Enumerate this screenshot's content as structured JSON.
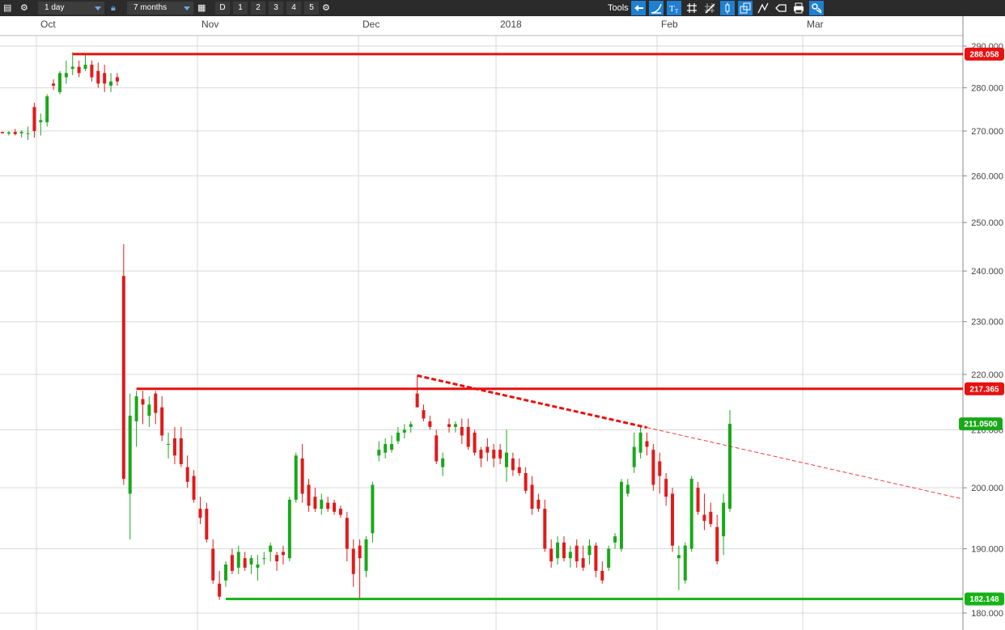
{
  "toolbar": {
    "interval": "1 day",
    "range": "7 months",
    "periods": [
      "D",
      "1",
      "2",
      "3",
      "4",
      "5"
    ],
    "tools_label": "Tools",
    "tool_icons": [
      "back-icon",
      "line-tool-icon",
      "text-tool-icon",
      "grid-icon",
      "draw-tool-icon",
      "candle-icon",
      "compare-icon",
      "indicator-icon",
      "label-icon",
      "print-icon",
      "settings-tool-icon"
    ]
  },
  "colors": {
    "up": "#1aa81a",
    "down": "#e01b1b",
    "resistance": "#e81010",
    "support": "#16b316",
    "grid": "#d9d9d9",
    "axis_text": "#444444"
  },
  "chart_data": {
    "type": "candlestick",
    "x_axis": {
      "labels": [
        "Oct",
        "Nov",
        "Dec",
        "2018",
        "Feb",
        "Mar"
      ]
    },
    "y_axis": {
      "ticks": [
        "290.000",
        "280.000",
        "270.000",
        "260.000",
        "250.000",
        "240.000",
        "230.000",
        "220.000",
        "210.000",
        "200.000",
        "190.000",
        "180.000"
      ],
      "log_scale": true,
      "range": [
        178.5,
        292
      ]
    },
    "grid": true,
    "horizontal_lines": [
      {
        "label": "288.058",
        "value": 288.058,
        "color": "#e81010"
      },
      {
        "label": "217.365",
        "value": 217.365,
        "color": "#e81010"
      },
      {
        "label": "182.148",
        "value": 182.148,
        "color": "#16b316"
      }
    ],
    "current_price": {
      "label": "211.0500",
      "value": 211.05
    },
    "trendline": {
      "from": [
        219.8,
        "early Dec"
      ],
      "to": [
        210.4,
        "late Jan"
      ],
      "style": "dashed-then-thin-extension"
    },
    "candles": [
      [
        269.8,
        269.8,
        269.4,
        269.5
      ],
      [
        269.4,
        270.0,
        269.0,
        269.7
      ],
      [
        269.8,
        270.5,
        269.0,
        269.3
      ],
      [
        269.5,
        270.2,
        268.5,
        269.8
      ],
      [
        269.5,
        271.0,
        268.0,
        269.5
      ],
      [
        275.5,
        276.5,
        268.5,
        270.0
      ],
      [
        272.0,
        274.0,
        269.0,
        272.5
      ],
      [
        272.0,
        278.5,
        271.0,
        278.0
      ],
      [
        281.0,
        282.0,
        279.5,
        280.5
      ],
      [
        279.0,
        284.0,
        278.5,
        283.5
      ],
      [
        282.5,
        286.5,
        281.0,
        283.5
      ],
      [
        284.5,
        288.5,
        283.0,
        285.0
      ],
      [
        285.0,
        286.5,
        282.5,
        283.5
      ],
      [
        284.5,
        288.0,
        284.0,
        285.5
      ],
      [
        285.5,
        286.5,
        281.5,
        282.5
      ],
      [
        284.0,
        286.0,
        280.0,
        281.0
      ],
      [
        283.5,
        285.5,
        279.0,
        281.0
      ],
      [
        280.5,
        283.5,
        279.0,
        281.5
      ],
      [
        282.5,
        283.5,
        280.5,
        281.5
      ],
      [
        239.0,
        245.5,
        200.5,
        201.5
      ],
      [
        199.0,
        216.5,
        191.5,
        212.5
      ],
      [
        211.5,
        217.0,
        207.0,
        216.0
      ],
      [
        215.5,
        217.0,
        211.0,
        214.5
      ],
      [
        212.5,
        216.0,
        210.5,
        214.5
      ],
      [
        216.5,
        217.0,
        211.0,
        213.0
      ],
      [
        214.0,
        216.0,
        208.0,
        209.0
      ],
      [
        207.5,
        209.5,
        205.0,
        207.5
      ],
      [
        208.5,
        210.5,
        204.0,
        205.5
      ],
      [
        208.5,
        210.5,
        203.5,
        204.0
      ],
      [
        203.5,
        205.5,
        200.0,
        201.0
      ],
      [
        202.0,
        203.0,
        197.5,
        198.0
      ],
      [
        196.5,
        198.5,
        194.0,
        195.0
      ],
      [
        196.5,
        197.5,
        191.0,
        191.5
      ],
      [
        190.0,
        191.5,
        184.5,
        185.0
      ],
      [
        184.5,
        186.5,
        182.0,
        182.5
      ],
      [
        185.0,
        188.0,
        184.0,
        187.5
      ],
      [
        189.0,
        190.0,
        186.0,
        186.5
      ],
      [
        187.0,
        190.5,
        186.0,
        189.5
      ],
      [
        188.5,
        189.5,
        186.5,
        187.0
      ],
      [
        187.5,
        189.0,
        186.0,
        188.5
      ],
      [
        187.0,
        189.0,
        185.0,
        187.5
      ],
      [
        188.5,
        189.5,
        187.5,
        188.5
      ],
      [
        189.5,
        191.0,
        188.0,
        190.5
      ],
      [
        189.0,
        189.5,
        186.5,
        188.0
      ],
      [
        189.5,
        190.5,
        187.5,
        189.0
      ],
      [
        188.5,
        198.5,
        188.0,
        198.0
      ],
      [
        198.0,
        206.0,
        197.5,
        205.5
      ],
      [
        205.0,
        207.5,
        197.5,
        199.0
      ],
      [
        200.5,
        201.5,
        196.0,
        197.0
      ],
      [
        198.5,
        200.0,
        196.0,
        196.5
      ],
      [
        196.5,
        199.0,
        195.5,
        198.0
      ],
      [
        197.5,
        198.5,
        196.0,
        196.5
      ],
      [
        197.5,
        198.0,
        195.5,
        196.0
      ],
      [
        196.5,
        197.0,
        195.0,
        195.5
      ],
      [
        195.0,
        196.0,
        188.0,
        190.0
      ],
      [
        190.0,
        191.5,
        184.0,
        186.0
      ],
      [
        190.5,
        191.5,
        182.0,
        188.5
      ],
      [
        186.5,
        192.0,
        185.5,
        191.5
      ],
      [
        192.5,
        201.0,
        191.0,
        200.5
      ],
      [
        205.5,
        208.0,
        204.5,
        206.5
      ],
      [
        206.0,
        208.5,
        205.0,
        207.5
      ],
      [
        206.5,
        209.0,
        206.0,
        207.5
      ],
      [
        208.0,
        210.5,
        207.5,
        209.5
      ],
      [
        209.5,
        211.0,
        208.5,
        210.0
      ],
      [
        210.5,
        211.5,
        209.5,
        211.0
      ],
      [
        216.5,
        219.8,
        214.0,
        214.0
      ],
      [
        213.5,
        214.5,
        211.5,
        212.0
      ],
      [
        211.5,
        212.5,
        210.0,
        210.5
      ],
      [
        209.0,
        210.0,
        204.0,
        204.5
      ],
      [
        203.5,
        206.0,
        202.0,
        205.0
      ],
      [
        211.0,
        212.0,
        209.5,
        210.5
      ],
      [
        210.5,
        211.5,
        209.5,
        211.0
      ],
      [
        210.5,
        212.0,
        207.5,
        209.0
      ],
      [
        210.5,
        212.0,
        206.5,
        207.0
      ],
      [
        209.5,
        210.0,
        205.5,
        206.0
      ],
      [
        206.5,
        207.0,
        203.5,
        205.0
      ],
      [
        207.0,
        208.5,
        204.5,
        206.0
      ],
      [
        206.5,
        207.5,
        203.5,
        205.0
      ],
      [
        206.5,
        207.5,
        204.0,
        205.0
      ],
      [
        203.5,
        210.0,
        201.0,
        206.0
      ],
      [
        205.0,
        206.0,
        202.0,
        203.0
      ],
      [
        203.5,
        205.0,
        202.0,
        202.5
      ],
      [
        202.5,
        203.5,
        199.0,
        199.5
      ],
      [
        200.5,
        202.0,
        195.5,
        196.5
      ],
      [
        198.0,
        199.0,
        196.0,
        196.5
      ],
      [
        196.5,
        198.0,
        189.5,
        190.0
      ],
      [
        190.0,
        191.5,
        187.0,
        188.0
      ],
      [
        188.5,
        192.0,
        187.5,
        191.0
      ],
      [
        191.0,
        192.0,
        188.0,
        188.5
      ],
      [
        188.5,
        190.5,
        187.0,
        189.5
      ],
      [
        190.5,
        191.5,
        187.0,
        188.0
      ],
      [
        188.5,
        190.5,
        186.5,
        187.0
      ],
      [
        189.0,
        191.5,
        187.5,
        190.5
      ],
      [
        190.5,
        191.0,
        185.5,
        186.5
      ],
      [
        186.5,
        188.0,
        184.5,
        185.0
      ],
      [
        187.0,
        190.5,
        186.5,
        190.0
      ],
      [
        191.0,
        192.5,
        190.0,
        192.0
      ],
      [
        190.0,
        201.5,
        189.5,
        201.0
      ],
      [
        199.0,
        201.5,
        198.5,
        200.5
      ],
      [
        203.5,
        209.5,
        202.5,
        207.0
      ],
      [
        206.0,
        210.5,
        205.0,
        209.5
      ],
      [
        208.0,
        209.5,
        205.5,
        207.0
      ],
      [
        206.5,
        207.5,
        199.5,
        200.5
      ],
      [
        204.5,
        206.0,
        199.0,
        202.0
      ],
      [
        201.5,
        202.5,
        197.0,
        198.5
      ],
      [
        199.0,
        200.0,
        189.5,
        190.5
      ],
      [
        188.5,
        190.5,
        183.5,
        189.0
      ],
      [
        185.0,
        191.0,
        184.5,
        190.5
      ],
      [
        190.0,
        202.0,
        189.5,
        201.5
      ],
      [
        200.0,
        201.0,
        195.5,
        196.0
      ],
      [
        195.5,
        199.0,
        193.0,
        194.5
      ],
      [
        196.0,
        197.5,
        193.5,
        194.0
      ],
      [
        193.5,
        195.5,
        187.5,
        188.0
      ],
      [
        192.0,
        199.0,
        189.0,
        197.5
      ],
      [
        196.5,
        213.5,
        196.0,
        211.05
      ]
    ]
  }
}
